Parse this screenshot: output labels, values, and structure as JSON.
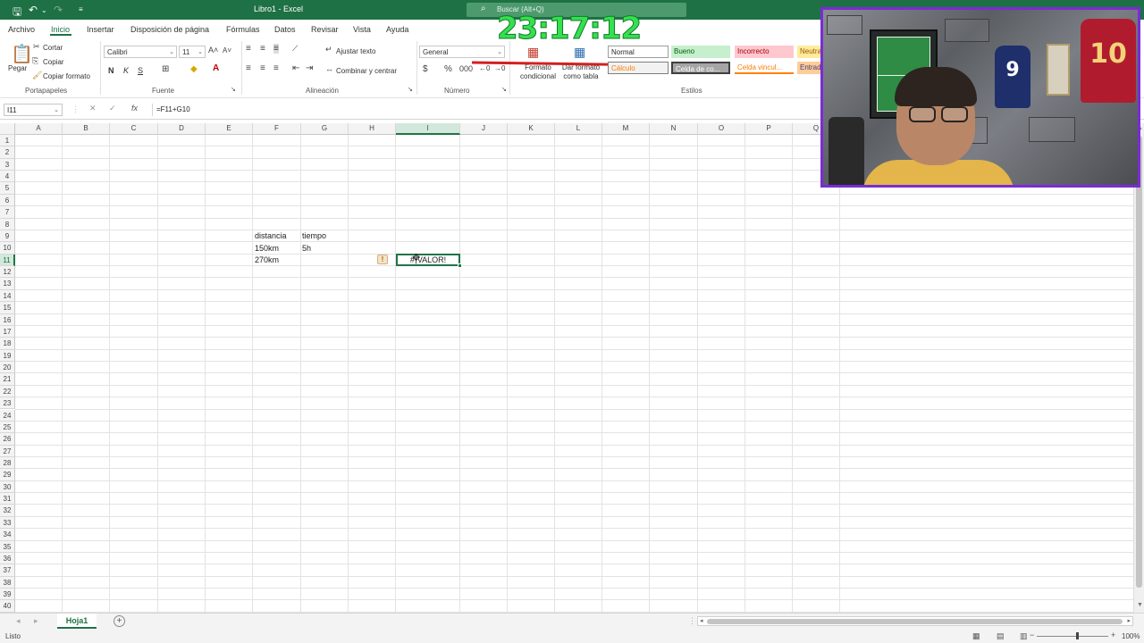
{
  "title_bar": {
    "doc_title": "Libro1 - Excel",
    "search_placeholder": "Buscar (Alt+Q)",
    "timer": "23:17:12"
  },
  "menu": {
    "tabs": [
      "Archivo",
      "Inicio",
      "Insertar",
      "Disposición de página",
      "Fórmulas",
      "Datos",
      "Revisar",
      "Vista",
      "Ayuda"
    ],
    "active": "Inicio"
  },
  "ribbon": {
    "portapapeles": {
      "paste": "Pegar",
      "cut": "Cortar",
      "copy": "Copiar",
      "format_painter": "Copiar formato",
      "label": "Portapapeles"
    },
    "fuente": {
      "font_name": "Calibri",
      "font_size": "11",
      "bold": "N",
      "italic": "K",
      "underline": "S",
      "label": "Fuente"
    },
    "alineacion": {
      "wrap": "Ajustar texto",
      "merge": "Combinar y centrar",
      "label": "Alineación"
    },
    "numero": {
      "format": "General",
      "label": "Número"
    },
    "estilos": {
      "conditional": "Formato condicional",
      "as_table": "Dar formato como tabla",
      "cells": [
        {
          "name": "Normal",
          "bg": "#ffffff",
          "fg": "#000000"
        },
        {
          "name": "Bueno",
          "bg": "#c6efce",
          "fg": "#006100"
        },
        {
          "name": "Incorrecto",
          "bg": "#ffc7ce",
          "fg": "#9c0006"
        },
        {
          "name": "Neutral",
          "bg": "#ffeb9c",
          "fg": "#9c5700"
        },
        {
          "name": "Cálculo",
          "bg": "#f2f2f2",
          "fg": "#fa7d00"
        },
        {
          "name": "Celda de co...",
          "bg": "#a5a5a5",
          "fg": "#ffffff"
        },
        {
          "name": "Celda vincul...",
          "bg": "#ffffff",
          "fg": "#fa7d00"
        },
        {
          "name": "Entrada",
          "bg": "#ffcc99",
          "fg": "#3f3f76"
        }
      ],
      "label": "Estilos"
    }
  },
  "formula_bar": {
    "name_box": "I11",
    "formula": "=F11+G10"
  },
  "grid": {
    "columns": [
      "A",
      "B",
      "C",
      "D",
      "E",
      "F",
      "G",
      "H",
      "I",
      "J",
      "K",
      "L",
      "M",
      "N",
      "O",
      "P",
      "Q"
    ],
    "selected_column": "I",
    "row_count": 40,
    "selected_row": 11,
    "cells": {
      "F9": "distancia",
      "G9": "tiempo",
      "F10": "150km",
      "G10": "5h",
      "F11": "270km",
      "I11": "#¡VALOR!"
    },
    "error_indicator": "!"
  },
  "sheets": {
    "tabs": [
      "Hoja1"
    ],
    "add": "+"
  },
  "status_bar": {
    "status": "Listo",
    "zoom": "100%"
  },
  "colors": {
    "excel_green": "#1e7145",
    "timer_green": "#35e04e",
    "webcam_border": "#7b2bd6"
  }
}
